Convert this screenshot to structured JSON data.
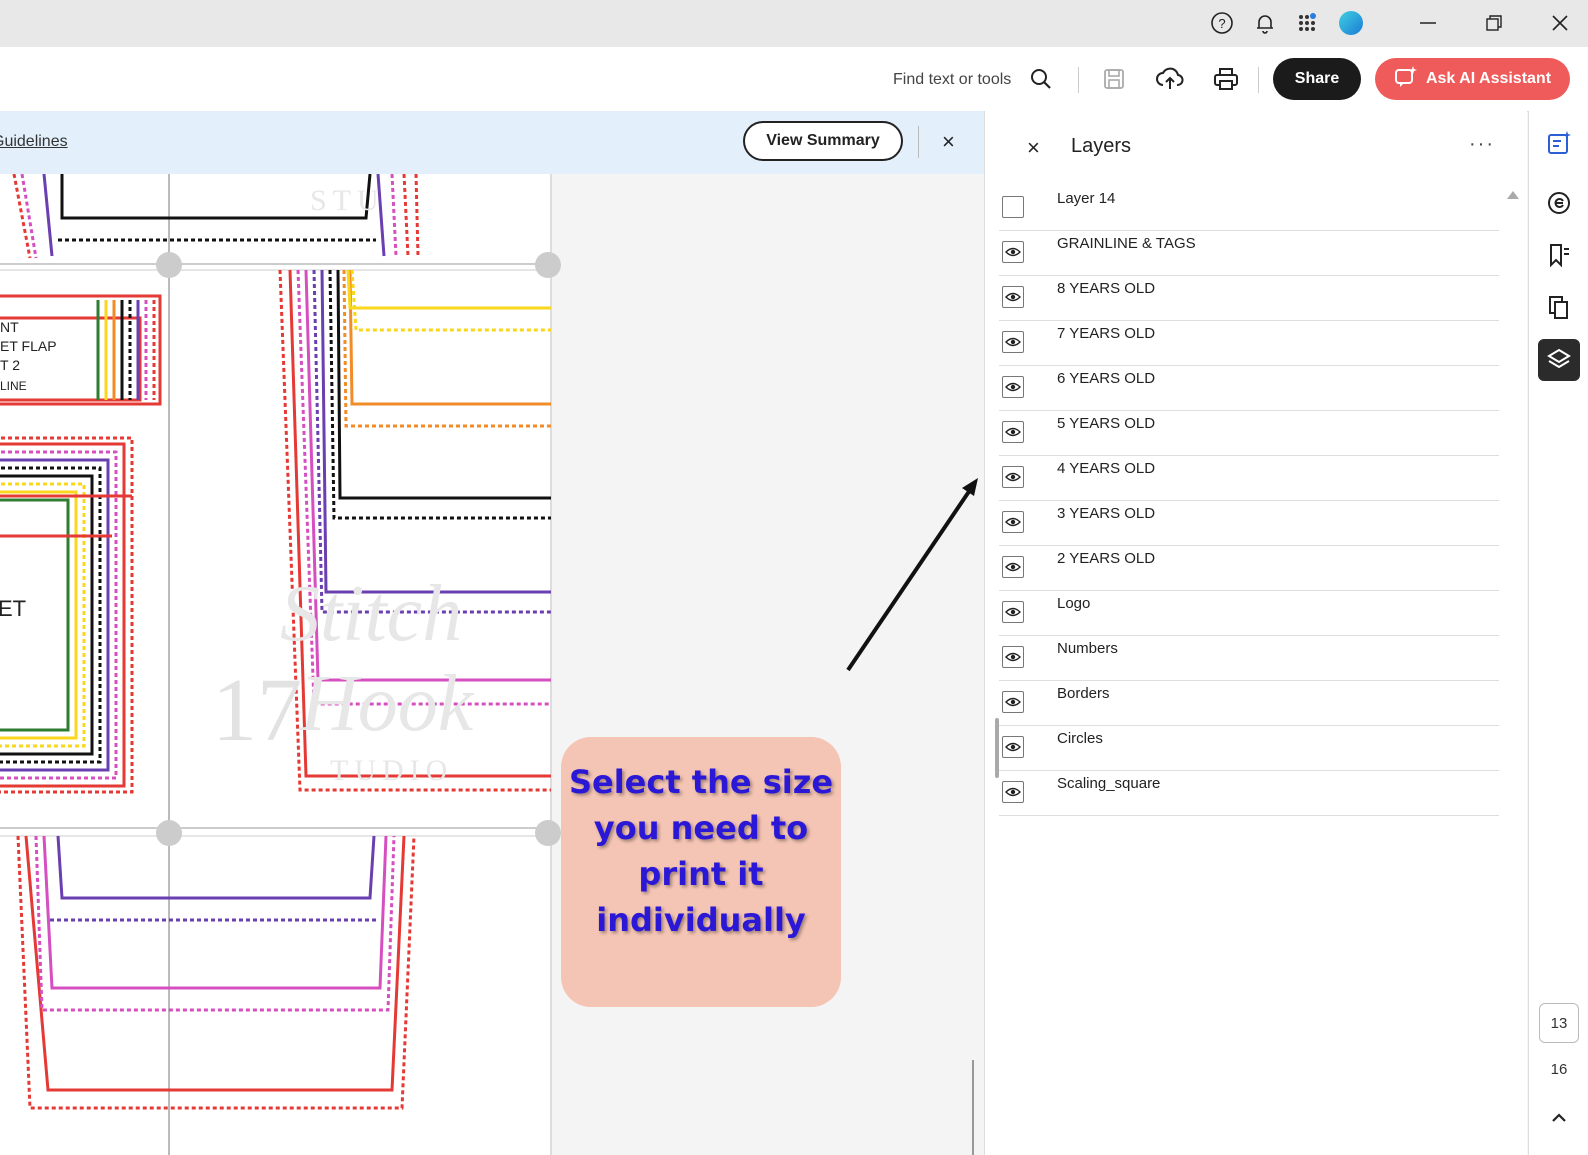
{
  "titlebar": {
    "icons": [
      "help-icon",
      "bell-icon",
      "apps-icon",
      "avatar",
      "minimize-icon",
      "restore-icon",
      "close-icon"
    ]
  },
  "toolbar": {
    "search_label": "Find text or tools",
    "share_label": "Share",
    "ai_label": "Ask AI Assistant",
    "accent_color": "#ef5a5a"
  },
  "banner": {
    "link_text": "Guidelines",
    "view_summary_label": "View Summary",
    "close_symbol": "×"
  },
  "document": {
    "watermark_number": "17",
    "pattern_labels": [
      "NT",
      "ET FLAP",
      "T 2",
      "LINE",
      "ET"
    ]
  },
  "callout": {
    "lines": [
      "Select the size",
      "you need to",
      "print it",
      "individually"
    ],
    "text_color": "#2b18d6",
    "bg_color": "#f4c4b4"
  },
  "layers_panel": {
    "title": "Layers",
    "close_symbol": "×",
    "more_symbol": "···",
    "layers": [
      {
        "name": "Layer 14",
        "visible": false
      },
      {
        "name": "GRAINLINE & TAGS",
        "visible": true
      },
      {
        "name": "8 YEARS OLD",
        "visible": true
      },
      {
        "name": "7 YEARS OLD",
        "visible": true
      },
      {
        "name": "6 YEARS OLD",
        "visible": true
      },
      {
        "name": "5 YEARS OLD",
        "visible": true
      },
      {
        "name": "4 YEARS OLD",
        "visible": true
      },
      {
        "name": "3 YEARS OLD",
        "visible": true
      },
      {
        "name": "2 YEARS OLD",
        "visible": true
      },
      {
        "name": "Logo",
        "visible": true
      },
      {
        "name": "Numbers",
        "visible": true
      },
      {
        "name": "Borders",
        "visible": true
      },
      {
        "name": "Circles",
        "visible": true
      },
      {
        "name": "Scaling_square",
        "visible": true
      }
    ]
  },
  "right_rail": {
    "current_page": "13",
    "total_pages": "16",
    "up_symbol": "^"
  }
}
